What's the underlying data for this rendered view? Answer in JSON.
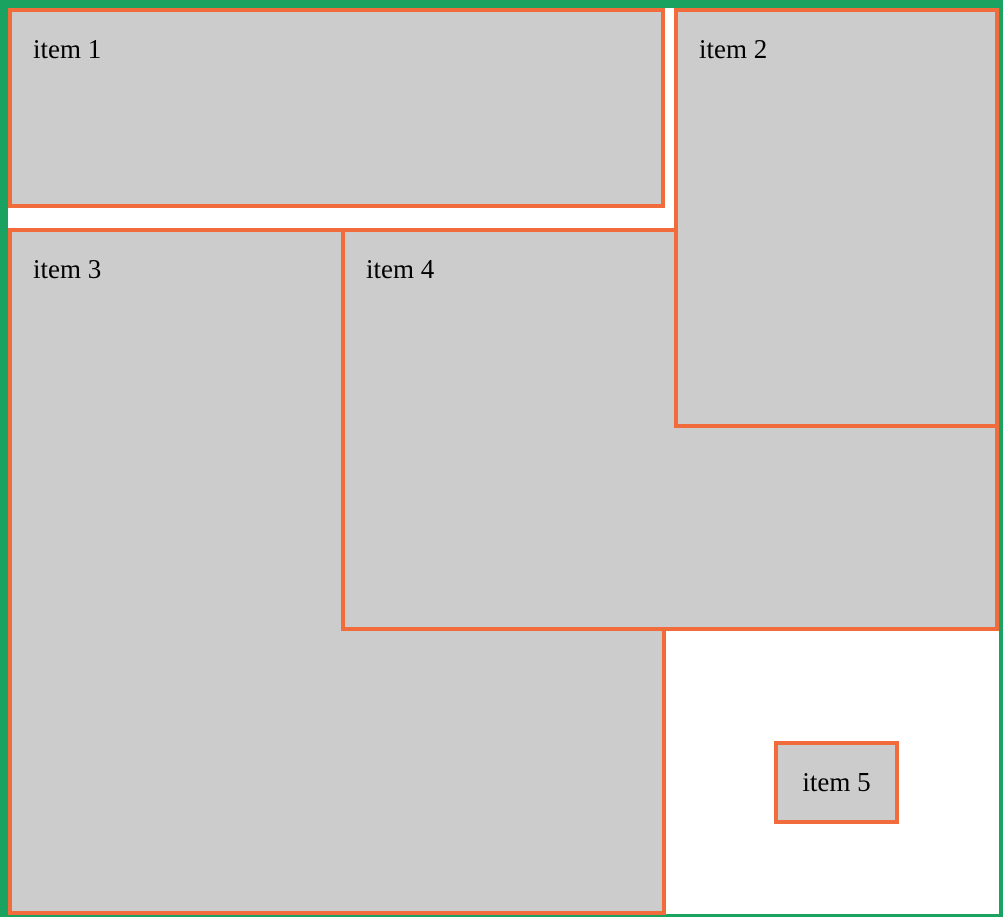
{
  "items": [
    {
      "label": "item 1"
    },
    {
      "label": "item 2"
    },
    {
      "label": "item 3"
    },
    {
      "label": "item 4"
    },
    {
      "label": "item 5"
    }
  ],
  "colors": {
    "container_border": "#1aa260",
    "item_border": "#f26b3a",
    "item_background": "#cccccc",
    "page_background": "#ffffff"
  }
}
